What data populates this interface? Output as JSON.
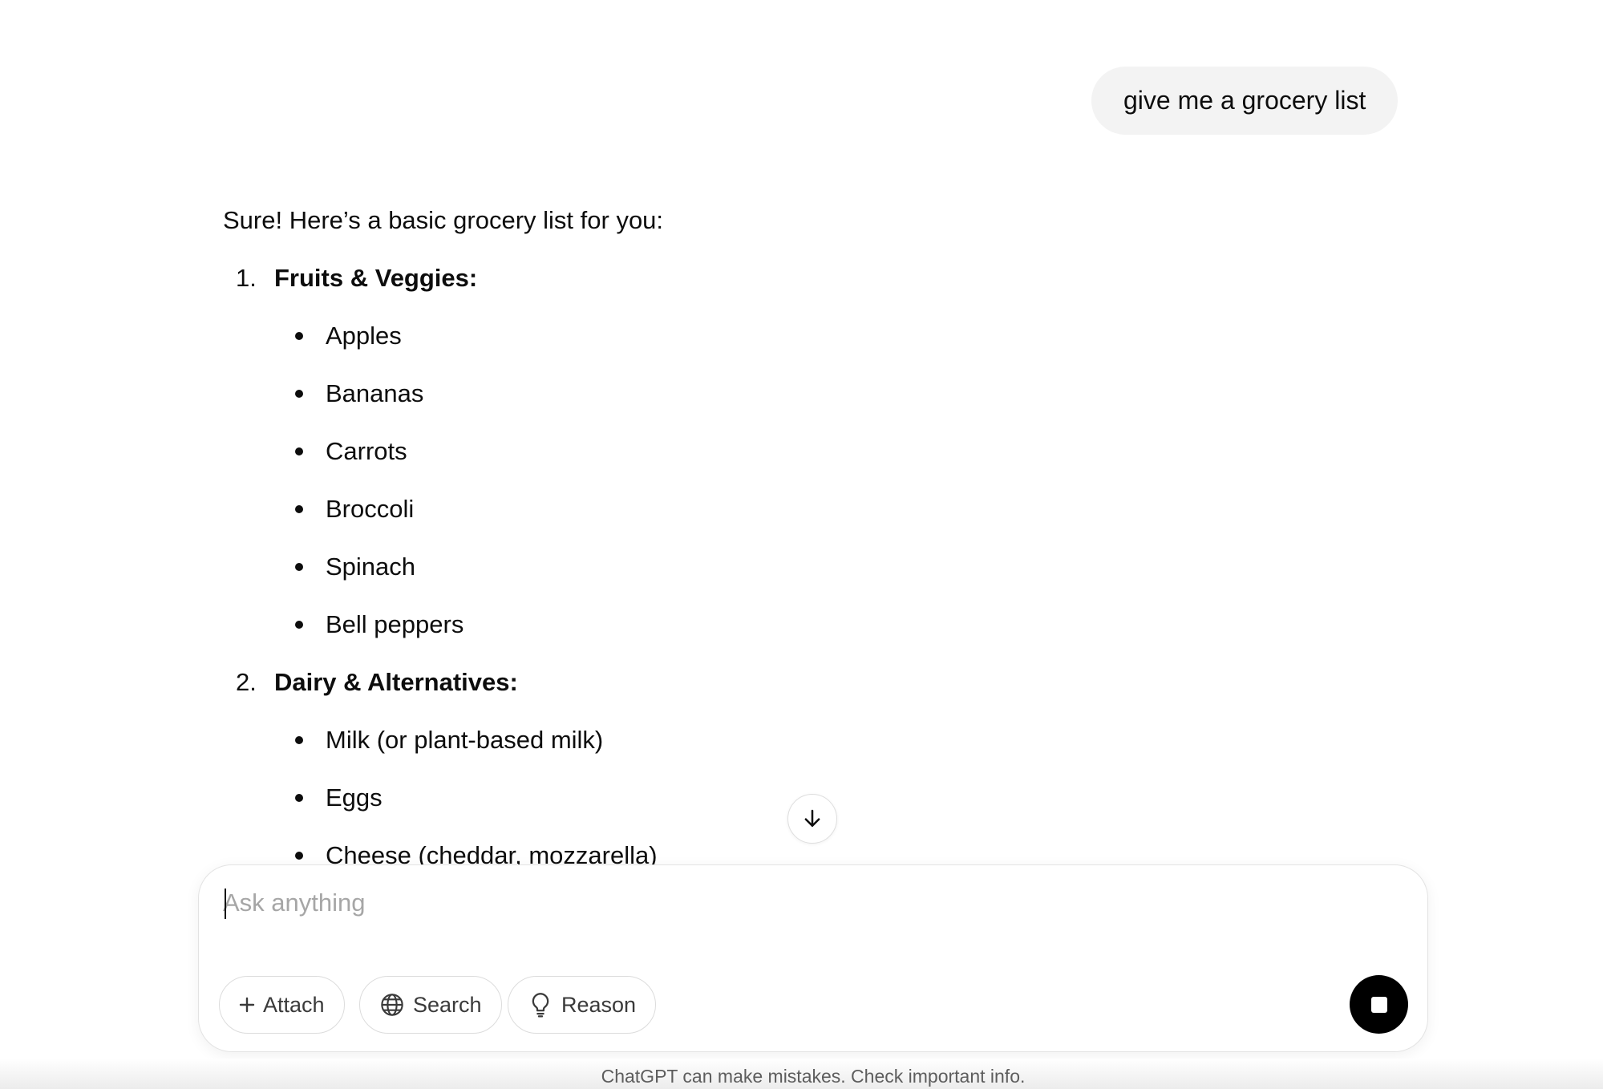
{
  "conversation": {
    "user_message": "give me a grocery list",
    "assistant": {
      "intro": "Sure! Here’s a basic grocery list for you:",
      "sections": [
        {
          "number": "1.",
          "title": "Fruits & Veggies:",
          "items": [
            "Apples",
            "Bananas",
            "Carrots",
            "Broccoli",
            "Spinach",
            "Bell peppers"
          ]
        },
        {
          "number": "2.",
          "title": "Dairy & Alternatives:",
          "items": [
            "Milk (or plant-based milk)",
            "Eggs",
            "Cheese (cheddar, mozzarella)"
          ]
        }
      ]
    }
  },
  "scroll_button": {
    "icon": "arrow-down-icon"
  },
  "composer": {
    "placeholder": "Ask anything",
    "value": "",
    "buttons": {
      "attach": {
        "label": "Attach",
        "icon": "plus-icon"
      },
      "search": {
        "label": "Search",
        "icon": "globe-icon"
      },
      "reason": {
        "label": "Reason",
        "icon": "lightbulb-icon"
      }
    },
    "stop_button": {
      "icon": "stop-icon"
    }
  },
  "footer": {
    "disclaimer": "ChatGPT can make mistakes. Check important info."
  }
}
